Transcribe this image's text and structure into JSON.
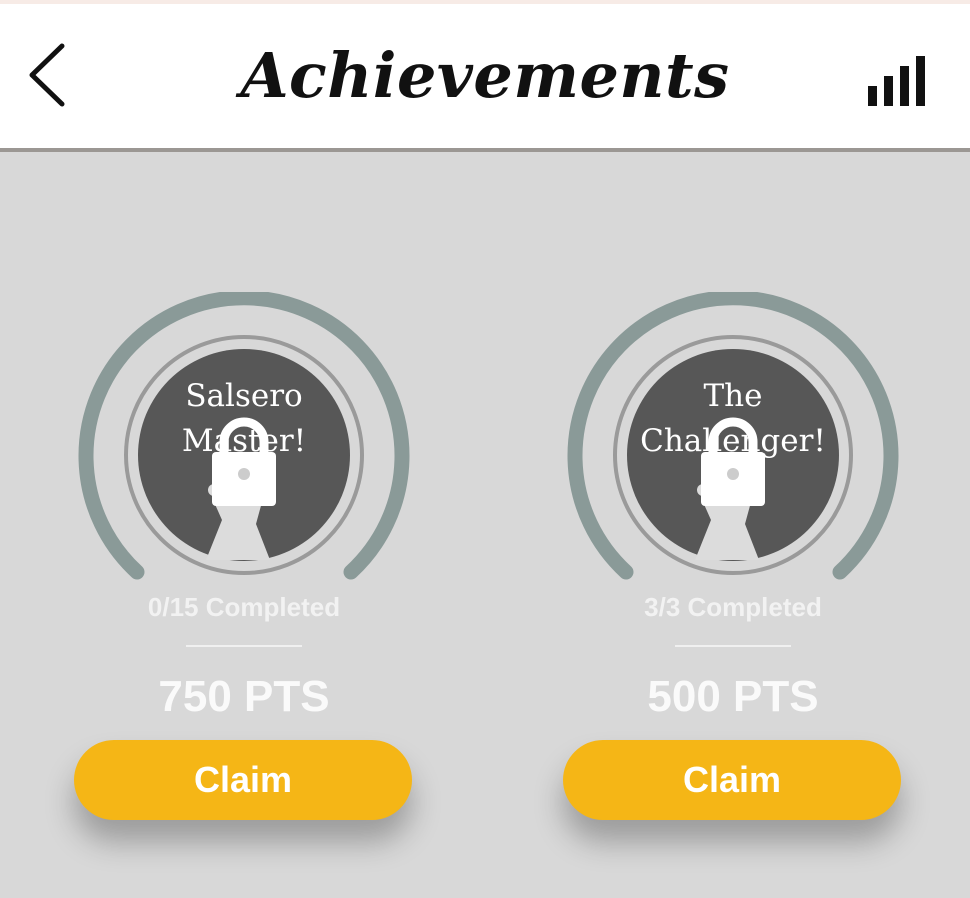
{
  "header": {
    "title": "Achievements",
    "back_icon": "chevron-left-icon",
    "stats_icon": "bar-chart-icon"
  },
  "achievements": [
    {
      "name_line1": "Salsero",
      "name_line2": "Master!",
      "progress": "0/15 Completed",
      "points": "750 PTS",
      "claim_label": "Claim",
      "locked": true
    },
    {
      "name_line1": "The",
      "name_line2": "Challenger!",
      "progress": "3/3 Completed",
      "points": "500 PTS",
      "claim_label": "Claim",
      "locked": true
    }
  ],
  "colors": {
    "background": "#d8d8d8",
    "ring": "#8a9a98",
    "badge": "#575757",
    "claim": "#f5b616"
  }
}
